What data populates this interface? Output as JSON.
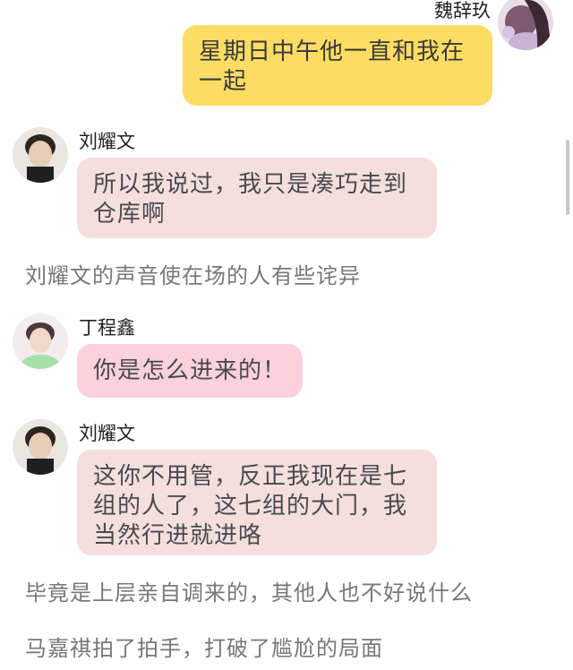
{
  "messages": [
    {
      "sender": "魏辞玖",
      "text": "星期日中午他一直和我在一起",
      "avatar": "avatar-icon"
    },
    {
      "sender": "刘耀文",
      "text": "所以我说过，我只是凑巧走到仓库啊",
      "avatar": "avatar-icon"
    },
    {
      "narration": "刘耀文的声音使在场的人有些诧异"
    },
    {
      "sender": "丁程鑫",
      "text": "你是怎么进来的！",
      "avatar": "avatar-icon"
    },
    {
      "sender": "刘耀文",
      "text": "这你不用管，反正我现在是七组的人了，这七组的大门，我当然行进就进咯",
      "avatar": "avatar-icon"
    },
    {
      "narration": "毕竟是上层亲自调来的，其他人也不好说什么"
    },
    {
      "narration": "马嘉祺拍了拍手，打破了尴尬的局面"
    }
  ],
  "colors": {
    "my_bubble": "#fcdc63",
    "their_bubble": "#f4dede",
    "pink_bubble": "#fbd1de",
    "narration_text": "#777777"
  }
}
